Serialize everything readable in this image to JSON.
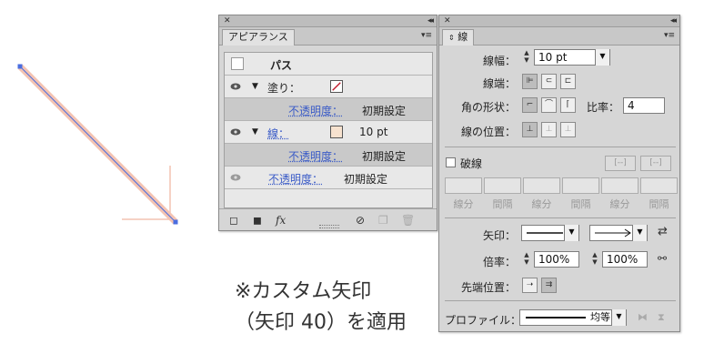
{
  "caption": {
    "line1": "※カスタム矢印",
    "line2": "（矢印 40）を適用"
  },
  "colors": {
    "stroke_pink": "#f4c3b2",
    "path_blue": "#4a6ee0",
    "link_blue": "#3a5bc7"
  },
  "appearance_panel": {
    "title": "アピアランス",
    "rows": [
      {
        "label": "パス"
      },
      {
        "label": "塗り：",
        "swatch": "none-red-slash"
      },
      {
        "label": "不透明度：",
        "value": "初期設定"
      },
      {
        "label": "線：",
        "value": "10 pt",
        "swatch": "light-peach"
      },
      {
        "label": "不透明度：",
        "value": "初期設定"
      },
      {
        "label": "不透明度：",
        "value": "初期設定"
      }
    ],
    "footer_icons": [
      "new-stroke-icon",
      "new-fill-icon",
      "fx-icon",
      "clear-icon",
      "duplicate-icon",
      "trash-icon"
    ]
  },
  "stroke_panel": {
    "title": "線",
    "weight": {
      "label": "線幅：",
      "value": "10 pt"
    },
    "cap": {
      "label": "線端："
    },
    "join": {
      "label": "角の形状：",
      "ratio_label": "比率：",
      "ratio_value": "4"
    },
    "align": {
      "label": "線の位置："
    },
    "dashed": {
      "label": "破線",
      "checked": false,
      "field_labels": [
        "線分",
        "間隔",
        "線分",
        "間隔",
        "線分",
        "間隔"
      ]
    },
    "arrow": {
      "label": "矢印："
    },
    "scale": {
      "label": "倍率：",
      "start": "100%",
      "end": "100%"
    },
    "align_tip": {
      "label": "先端位置："
    },
    "profile": {
      "label": "プロファイル：",
      "value": "均等"
    }
  }
}
